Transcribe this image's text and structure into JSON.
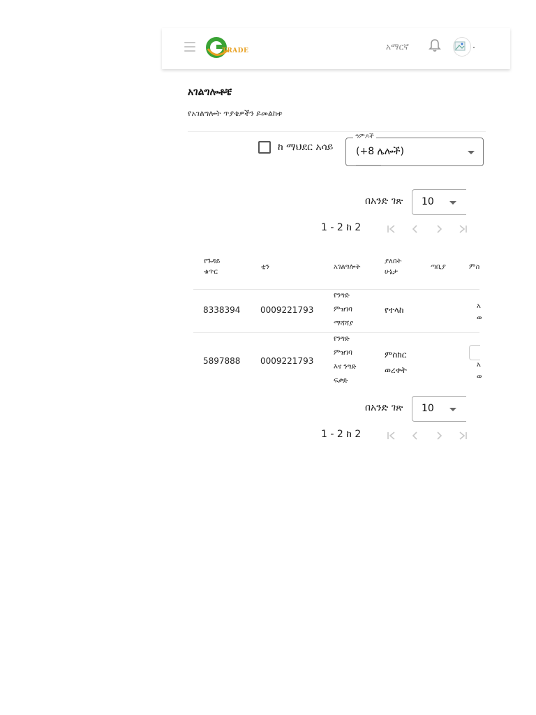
{
  "header": {
    "logo_text": "TRADE",
    "language": "አማርኛ",
    "icons": [
      "menu-icon",
      "bell-icon",
      "avatar"
    ]
  },
  "page": {
    "title": "አገልግሎቶቼ",
    "subtitle": "የአገልግሎት ጥያቄዎችን ይመልከቱ"
  },
  "filters": {
    "checkbox_label": "ከ ማህደር አሳይ",
    "checkbox_checked": false,
    "types_legend": "ዓምዶች",
    "types_value": "(+8 ሌሎች)"
  },
  "pagination_top": {
    "per_page_label": "በአንድ ገጽ",
    "per_page_value": "10",
    "range_text": "1 - 2 ከ 2"
  },
  "pagination_bottom": {
    "per_page_label": "በአንድ ገጽ",
    "per_page_value": "10",
    "range_text": "1 - 2 ከ 2"
  },
  "table": {
    "headers": [
      "የጉዳይ ቁጥር",
      "ቲን",
      "አገልግሎት",
      "ያለበት ሁኔታ",
      "ጣቢያ",
      "ምስ"
    ],
    "header_lines": {
      "case_l1": "የጉዳይ",
      "case_l2": "ቁጥር",
      "status_l1": "ያለበት",
      "status_l2": "ሁኔታ"
    },
    "rows": [
      {
        "case": "8338394",
        "tin": "0009221793",
        "service_lines": [
          "የንግድ",
          "ምዝገባ",
          "ማሻሻያ"
        ],
        "status_lines": [
          "የተላከ"
        ],
        "station": "",
        "action_lines": [
          "አ",
          "ወ"
        ]
      },
      {
        "case": "5897888",
        "tin": "0009221793",
        "service_lines": [
          "የንግድ",
          "ምዝገባ",
          "እና ንግድ",
          "ፍቃድ"
        ],
        "status_lines": [
          "ምስክር",
          "ወረቀት"
        ],
        "station": "",
        "action_lines": [
          "አ",
          "ወ"
        ]
      }
    ]
  },
  "colors": {
    "logo_green": "#3aa335",
    "logo_orange": "#e8a020",
    "muted_icon": "#c8c8c8"
  }
}
